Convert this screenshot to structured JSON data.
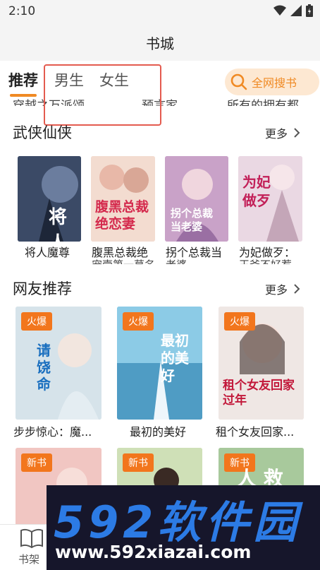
{
  "status": {
    "time": "2:10"
  },
  "header": {
    "title": "书城"
  },
  "tabs": [
    {
      "label": "推荐"
    },
    {
      "label": "男生"
    },
    {
      "label": "女生"
    }
  ],
  "search": {
    "label": "全网搜书"
  },
  "cut_titles_top": [
    "穿越之万派颂...",
    "预言家",
    "所有的拥有都..."
  ],
  "sections": [
    {
      "title": "武侠仙侠",
      "more": "更多",
      "books": [
        {
          "title": "将人魔尊",
          "cover_text": "将人",
          "cover_color": "#3b4a66"
        },
        {
          "title": "腹黑总裁绝",
          "cut": "宠壹第一莫名",
          "cover_text": "腹黑总裁 绝恋妻",
          "cover_color": "#f3dcd0"
        },
        {
          "title": "拐个总裁当",
          "cut": "老婆",
          "cover_text": "拐个总裁 当老婆",
          "cover_color": "#c9a2c8"
        },
        {
          "title": "为妃做歹：",
          "cut": "王爷不好惹",
          "cover_text": "为妃做歹",
          "cover_color": "#ead8e3"
        }
      ]
    },
    {
      "title": "网友推荐",
      "more": "更多",
      "books": [
        {
          "title": "步步惊心：魔...",
          "tag": "火爆",
          "cover_text": "请饶命",
          "cover_color": "#d6e3ea"
        },
        {
          "title": "最初的美好",
          "tag": "火爆",
          "cover_text": "最初的美好",
          "cover_color": "#6fb7d8"
        },
        {
          "title": "租个女友回家...",
          "tag": "火爆",
          "cover_text": "租个女友回家过年",
          "cover_color": "#efe7e4"
        }
      ]
    },
    {
      "books": [
        {
          "tag": "新书",
          "cover_color": "#f1c6c2"
        },
        {
          "tag": "新书",
          "cover_color": "#cfe0b7"
        },
        {
          "tag": "新书",
          "cover_text": "人 救",
          "cover_color": "#a8c99c"
        }
      ]
    }
  ],
  "bottom_nav": {
    "shelf_label": "书架"
  },
  "watermark": {
    "brand": "592软件园",
    "url": "www.592xiazai.com"
  }
}
